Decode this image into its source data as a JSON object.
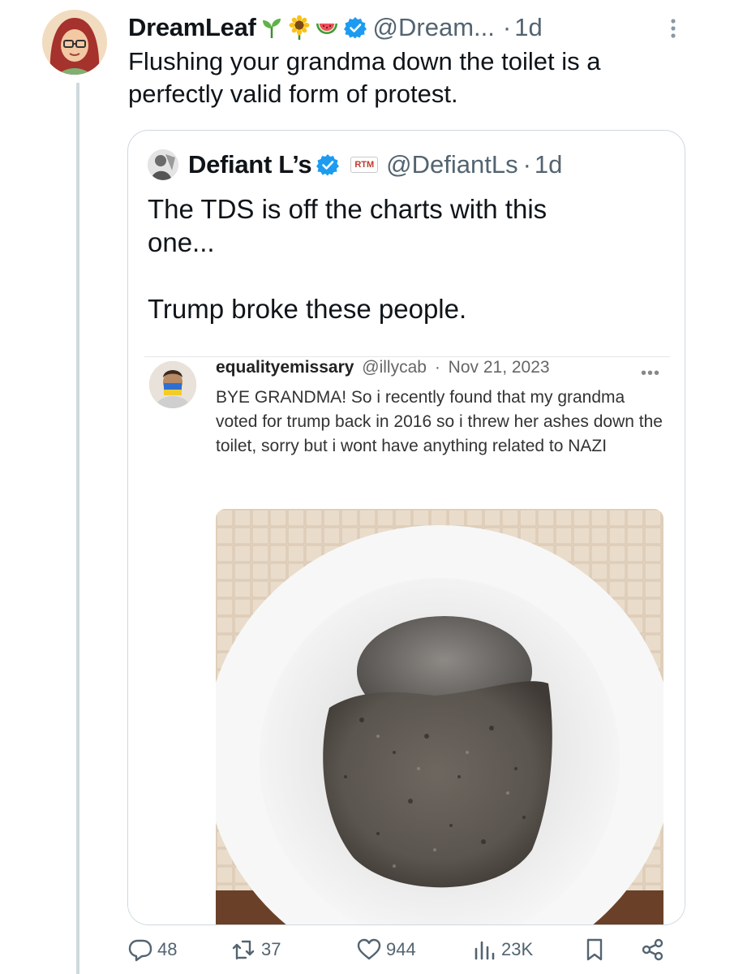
{
  "tweet": {
    "author": {
      "display_name": "DreamLeaf",
      "emojis": [
        "seedling-emoji",
        "sunflower-emoji",
        "watermelon-emoji"
      ],
      "verified": true,
      "handle": "@Dream...",
      "separator": "·",
      "time": "1d"
    },
    "text": "Flushing your grandma down the toilet is a perfectly valid form of protest.",
    "quote": {
      "display_name": "Defiant L’s",
      "verified": true,
      "badge": "RTM",
      "handle": "@DefiantLs",
      "separator": "·",
      "time": "1d",
      "text": "The TDS is off the charts with this\none...\n\nTrump broke these people.",
      "screenshot": {
        "name": "equalityemissary",
        "handle": "@illycab",
        "separator": "·",
        "date": "Nov 21, 2023",
        "more": "•••",
        "text": "BYE GRANDMA! So i recently found that my grandma voted for trump back in 2016 so i threw her ashes down the toilet, sorry but i wont have anything related to NAZI"
      }
    },
    "actions": {
      "replies": "48",
      "reposts": "37",
      "likes": "944",
      "views": "23K"
    }
  },
  "colors": {
    "text": "#0f1419",
    "secondary": "#536471",
    "verified": "#1d9bf0",
    "border": "#cfd9de"
  }
}
